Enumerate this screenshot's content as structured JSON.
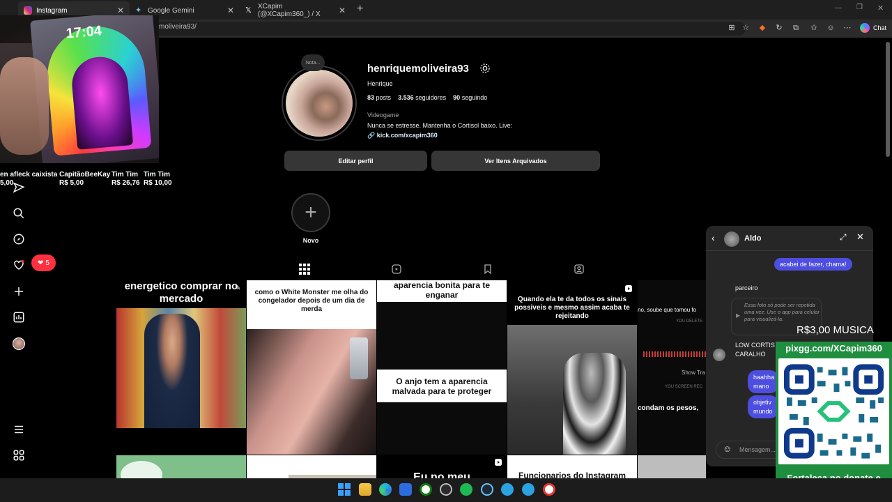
{
  "browser": {
    "tabs": [
      {
        "label": "Instagram"
      },
      {
        "label": "Google Gemini"
      },
      {
        "label": "XCapim (@XCapim360_) / X"
      }
    ],
    "url": "moliveira93/",
    "chat_label": "Chat"
  },
  "donations": [
    {
      "name": "en afleck caixista",
      "amount": "5,00"
    },
    {
      "name": "CapitãoBeeKay",
      "amount": "R$ 5,00"
    },
    {
      "name": "Tim Tim",
      "amount": "R$ 26,76"
    },
    {
      "name": "Tim Tim",
      "amount": "R$ 10,00"
    }
  ],
  "webcam": {
    "clock": "17:04"
  },
  "sidebar": {
    "notification_count": "5"
  },
  "profile": {
    "note": "Nota...",
    "username": "henriquemoliveira93",
    "full_name": "Henrique",
    "posts_count": "83",
    "posts_label": "posts",
    "followers_count": "3.536",
    "followers_label": "seguidores",
    "following_count": "90",
    "following_label": "seguindo",
    "category": "Videogame",
    "bio": "Nunca se estresse. Mantenha o Cortisol baixo. Live:",
    "link": "kick.com/xcapim360",
    "edit_button": "Editar perfil",
    "archive_button": "Ver Itens Arquivados",
    "highlight_new": "Novo"
  },
  "posts": [
    {
      "caption": "energetico comprar no mercado"
    },
    {
      "caption": "como o White Monster me olha do congelador depois de um dia de merda"
    },
    {
      "caption": "aparencia bonita para te enganar",
      "caption2": "O anjo tem a aparencia malvada para te proteger"
    },
    {
      "caption": "Quando ela te da todos os sinais possiveis e mesmo assim acaba te rejeitando"
    },
    {
      "caption": "no, soube que tomou fo",
      "caption2": "condam os pesos,",
      "sub1": "YOU DELETE",
      "sub2": "Show Tra",
      "sub3": "YOU SCREEN REC"
    },
    {
      "caption": "Eu no meu"
    },
    {
      "caption": "Funcionarios do Instagram"
    }
  ],
  "chat": {
    "name": "Aldo",
    "messages": [
      {
        "from": "me",
        "text": "acabei de fazer, chama!"
      },
      {
        "from": "them",
        "text": "parceiro"
      },
      {
        "from": "them",
        "text": "Essa foto só pode ser repetida uma vez. Use o app para celular para visualizá-la."
      },
      {
        "from": "them",
        "text": "LOW CORTIS CARALHO"
      },
      {
        "from": "me",
        "text": "haahha mano"
      },
      {
        "from": "me",
        "text": "objetiv mundo"
      }
    ],
    "input_placeholder": "Mensagem..."
  },
  "overlay": {
    "price": "R$3,00 MUSICA",
    "url": "pixgg.com/XCapim360",
    "footer": "Fortaleça no donate e envie sua mensagem!"
  },
  "colors": {
    "accent": "#4d4ddf",
    "link": "#e0f1ff",
    "notif": "#ff3040",
    "qr_green": "#1f8f3f"
  }
}
